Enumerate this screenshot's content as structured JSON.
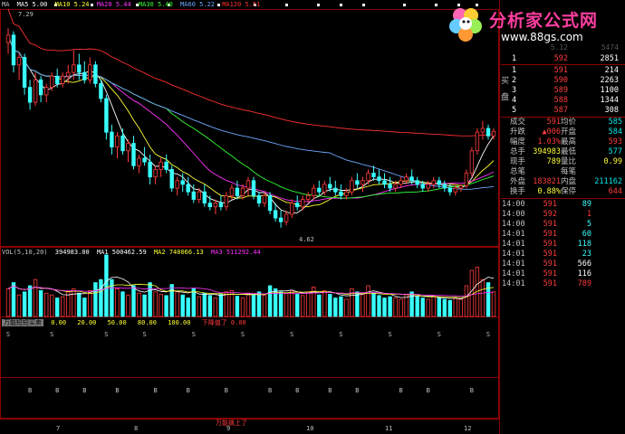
{
  "ma_bar": {
    "ma_label": "MA",
    "ma5": "MA5 5.00",
    "ma10": "MA10 5.24",
    "ma20": "MA20 5.44",
    "ma30": "MA30 5.40",
    "ma60": "MA60 5.22",
    "ma120": "MA120 5.51"
  },
  "price_labels": {
    "high": "7.29",
    "low": "4.62"
  },
  "vol_bar": {
    "title": "VOL(5,10,20)",
    "vol": "394983.00",
    "ma1": "MA1 500462.59",
    "ma2": "MA2 740066.13",
    "ma3": "MA3 511292.44"
  },
  "indicator_bar": {
    "title": "万能短短买卖",
    "levels": [
      "0.00",
      "20.00",
      "50.00",
      "80.00",
      "100.00"
    ],
    "zero_label": "下降值了 0.00"
  },
  "bs_marks": {
    "s": "S",
    "b": "B"
  },
  "x_axis": {
    "months": [
      "7",
      "8",
      "9",
      "10",
      "11",
      "12"
    ],
    "bottom_label": "万能擒上了"
  },
  "logo": {
    "title": "分析家公式网",
    "url": "www.88gs.com"
  },
  "top_partial": {
    "price": "5.12",
    "vol": "5474"
  },
  "order_book": {
    "sell_label": "卖",
    "buy_label": "买",
    "pan_label": "盘",
    "sell": [
      {
        "n": "1",
        "p": "592",
        "v": "2851"
      }
    ],
    "buy": [
      {
        "n": "1",
        "p": "591",
        "v": "214"
      },
      {
        "n": "2",
        "p": "590",
        "v": "2263"
      },
      {
        "n": "3",
        "p": "589",
        "v": "1100"
      },
      {
        "n": "4",
        "p": "588",
        "v": "1344"
      },
      {
        "n": "5",
        "p": "587",
        "v": "308"
      }
    ]
  },
  "stats": [
    {
      "l": "成交",
      "v": "591",
      "l2": "均价",
      "v2": "585"
    },
    {
      "l": "升跌",
      "v": "▲006",
      "l2": "开盘",
      "v2": "584"
    },
    {
      "l": "幅度",
      "v": "1.03%",
      "l2": "最高",
      "v2": "593"
    },
    {
      "l": "总手",
      "v": "394983",
      "l2": "最低",
      "v2": "577"
    },
    {
      "l": "现手",
      "v": "789",
      "l2": "量比",
      "v2": "0.99"
    },
    {
      "l": "总笔",
      "v": "",
      "l2": "每笔",
      "v2": ""
    },
    {
      "l": "外盘",
      "v": "183821",
      "l2": "内盘",
      "v2": "211162"
    },
    {
      "l": "换手",
      "v": "0.88%",
      "l2": "保停",
      "v2": "644"
    }
  ],
  "ticks": [
    {
      "t": "14:00",
      "p": "591",
      "q": "89",
      "k": ""
    },
    {
      "t": "14:00",
      "p": "592",
      "q": "1",
      "k": ""
    },
    {
      "t": "14:00",
      "p": "591",
      "q": "5",
      "k": ""
    },
    {
      "t": "14:01",
      "p": "591",
      "q": "60",
      "k": ""
    },
    {
      "t": "14:01",
      "p": "591",
      "q": "118",
      "k": ""
    },
    {
      "t": "14:01",
      "p": "591",
      "q": "23",
      "k": ""
    },
    {
      "t": "14:01",
      "p": "591",
      "q": "566",
      "k": ""
    },
    {
      "t": "14:01",
      "p": "591",
      "q": "116",
      "k": ""
    },
    {
      "t": "14:01",
      "p": "591",
      "q": "789",
      "k": ""
    }
  ],
  "colors": {
    "up": "#ff3b3b",
    "down": "#39ffff",
    "ma5": "#ffffff",
    "ma10": "#ffff33",
    "ma20": "#ff33ff",
    "ma30": "#33ff33",
    "ma60": "#6fa8ff",
    "ma120": "#ff3030",
    "grid": "#8b0000"
  },
  "chart_data": {
    "type": "candlestick",
    "description_units": "price",
    "ylim": [
      4.4,
      7.5
    ],
    "candles": [
      [
        7.1,
        7.29,
        6.95,
        7.2
      ],
      [
        7.2,
        7.25,
        6.7,
        6.8
      ],
      [
        6.8,
        6.95,
        6.6,
        6.9
      ],
      [
        6.9,
        6.95,
        6.4,
        6.5
      ],
      [
        6.5,
        6.6,
        6.2,
        6.3
      ],
      [
        6.3,
        6.7,
        6.25,
        6.6
      ],
      [
        6.6,
        6.65,
        6.3,
        6.4
      ],
      [
        6.4,
        6.55,
        6.3,
        6.5
      ],
      [
        6.5,
        6.7,
        6.45,
        6.65
      ],
      [
        6.65,
        6.75,
        6.5,
        6.55
      ],
      [
        6.55,
        6.7,
        6.5,
        6.65
      ],
      [
        6.65,
        6.8,
        6.55,
        6.7
      ],
      [
        6.7,
        7.0,
        6.6,
        6.8
      ],
      [
        6.8,
        6.95,
        6.6,
        6.7
      ],
      [
        6.7,
        6.85,
        6.55,
        6.6
      ],
      [
        6.6,
        6.9,
        6.55,
        6.8
      ],
      [
        6.8,
        6.85,
        6.5,
        6.55
      ],
      [
        6.55,
        6.6,
        6.3,
        6.35
      ],
      [
        6.35,
        6.4,
        5.8,
        5.9
      ],
      [
        5.9,
        6.0,
        5.6,
        5.7
      ],
      [
        5.7,
        5.9,
        5.55,
        5.85
      ],
      [
        5.85,
        5.95,
        5.6,
        5.65
      ],
      [
        5.65,
        5.8,
        5.5,
        5.75
      ],
      [
        5.75,
        5.85,
        5.4,
        5.45
      ],
      [
        5.45,
        5.6,
        5.35,
        5.55
      ],
      [
        5.55,
        5.7,
        5.45,
        5.5
      ],
      [
        5.5,
        5.6,
        5.2,
        5.3
      ],
      [
        5.3,
        5.45,
        5.2,
        5.4
      ],
      [
        5.4,
        5.55,
        5.3,
        5.5
      ],
      [
        5.5,
        5.6,
        5.35,
        5.4
      ],
      [
        5.4,
        5.45,
        5.1,
        5.15
      ],
      [
        5.15,
        5.3,
        5.05,
        5.25
      ],
      [
        5.25,
        5.35,
        5.1,
        5.2
      ],
      [
        5.2,
        5.3,
        5.05,
        5.1
      ],
      [
        5.1,
        5.2,
        4.95,
        5.0
      ],
      [
        5.0,
        5.15,
        4.95,
        5.1
      ],
      [
        5.1,
        5.2,
        4.9,
        4.95
      ],
      [
        4.95,
        5.05,
        4.85,
        4.9
      ],
      [
        4.9,
        5.0,
        4.8,
        4.95
      ],
      [
        4.95,
        5.05,
        4.85,
        4.9
      ],
      [
        4.9,
        5.1,
        4.85,
        5.05
      ],
      [
        5.05,
        5.2,
        5.0,
        5.15
      ],
      [
        5.15,
        5.25,
        5.0,
        5.05
      ],
      [
        5.05,
        5.2,
        5.0,
        5.15
      ],
      [
        5.15,
        5.3,
        5.05,
        5.25
      ],
      [
        5.25,
        5.3,
        5.0,
        5.05
      ],
      [
        5.05,
        5.1,
        4.9,
        4.95
      ],
      [
        4.95,
        5.1,
        4.9,
        5.05
      ],
      [
        5.05,
        5.1,
        4.8,
        4.85
      ],
      [
        4.85,
        4.95,
        4.7,
        4.75
      ],
      [
        4.75,
        4.85,
        4.62,
        4.7
      ],
      [
        4.7,
        4.85,
        4.65,
        4.8
      ],
      [
        4.8,
        5.0,
        4.75,
        4.95
      ],
      [
        4.95,
        5.05,
        4.85,
        4.9
      ],
      [
        4.9,
        5.05,
        4.85,
        5.0
      ],
      [
        5.0,
        5.1,
        4.95,
        5.05
      ],
      [
        5.05,
        5.2,
        5.0,
        5.15
      ],
      [
        5.15,
        5.25,
        5.05,
        5.1
      ],
      [
        5.1,
        5.25,
        5.05,
        5.2
      ],
      [
        5.2,
        5.3,
        5.1,
        5.15
      ],
      [
        5.15,
        5.25,
        5.05,
        5.1
      ],
      [
        5.1,
        5.2,
        5.0,
        5.05
      ],
      [
        5.05,
        5.15,
        5.0,
        5.1
      ],
      [
        5.1,
        5.3,
        5.05,
        5.25
      ],
      [
        5.25,
        5.35,
        5.15,
        5.2
      ],
      [
        5.2,
        5.3,
        5.1,
        5.25
      ],
      [
        5.25,
        5.4,
        5.2,
        5.35
      ],
      [
        5.35,
        5.45,
        5.25,
        5.3
      ],
      [
        5.3,
        5.4,
        5.2,
        5.25
      ],
      [
        5.25,
        5.35,
        5.15,
        5.2
      ],
      [
        5.2,
        5.3,
        5.1,
        5.15
      ],
      [
        5.15,
        5.25,
        5.1,
        5.2
      ],
      [
        5.2,
        5.3,
        5.15,
        5.25
      ],
      [
        5.25,
        5.35,
        5.2,
        5.3
      ],
      [
        5.3,
        5.4,
        5.2,
        5.25
      ],
      [
        5.25,
        5.3,
        5.15,
        5.2
      ],
      [
        5.2,
        5.25,
        5.1,
        5.15
      ],
      [
        5.15,
        5.25,
        5.1,
        5.2
      ],
      [
        5.2,
        5.3,
        5.15,
        5.25
      ],
      [
        5.25,
        5.3,
        5.15,
        5.2
      ],
      [
        5.2,
        5.25,
        5.1,
        5.15
      ],
      [
        5.15,
        5.2,
        5.05,
        5.1
      ],
      [
        5.1,
        5.2,
        5.05,
        5.15
      ],
      [
        5.15,
        5.2,
        5.1,
        5.18
      ],
      [
        5.18,
        5.4,
        5.15,
        5.35
      ],
      [
        5.35,
        5.7,
        5.3,
        5.65
      ],
      [
        5.65,
        5.95,
        5.6,
        5.9
      ],
      [
        5.9,
        6.05,
        5.8,
        5.95
      ],
      [
        5.95,
        6.0,
        5.8,
        5.85
      ],
      [
        5.85,
        5.95,
        5.8,
        5.91
      ]
    ],
    "ma_close_count": 90,
    "volumes": [
      0.45,
      0.55,
      0.35,
      0.4,
      0.5,
      0.6,
      0.42,
      0.38,
      0.35,
      0.3,
      0.32,
      0.4,
      0.45,
      0.38,
      0.3,
      0.42,
      0.55,
      0.6,
      1.0,
      0.6,
      0.45,
      0.4,
      0.35,
      0.5,
      0.38,
      0.35,
      0.55,
      0.4,
      0.36,
      0.34,
      0.52,
      0.4,
      0.35,
      0.3,
      0.45,
      0.32,
      0.38,
      0.34,
      0.3,
      0.36,
      0.4,
      0.42,
      0.33,
      0.3,
      0.38,
      0.36,
      0.4,
      0.34,
      0.5,
      0.45,
      0.4,
      0.38,
      0.42,
      0.36,
      0.34,
      0.4,
      0.48,
      0.35,
      0.42,
      0.36,
      0.3,
      0.32,
      0.28,
      0.45,
      0.4,
      0.36,
      0.5,
      0.38,
      0.34,
      0.3,
      0.32,
      0.3,
      0.28,
      0.36,
      0.4,
      0.32,
      0.3,
      0.28,
      0.34,
      0.3,
      0.28,
      0.26,
      0.3,
      0.28,
      0.5,
      0.75,
      0.8,
      0.6,
      0.55,
      0.4
    ],
    "s_positions": [
      0,
      8,
      18,
      25,
      34,
      43,
      52,
      61,
      70,
      79,
      88
    ],
    "b_positions": [
      4,
      9,
      14,
      20,
      27,
      33,
      40,
      48,
      53,
      59,
      64,
      72,
      77,
      85
    ]
  }
}
